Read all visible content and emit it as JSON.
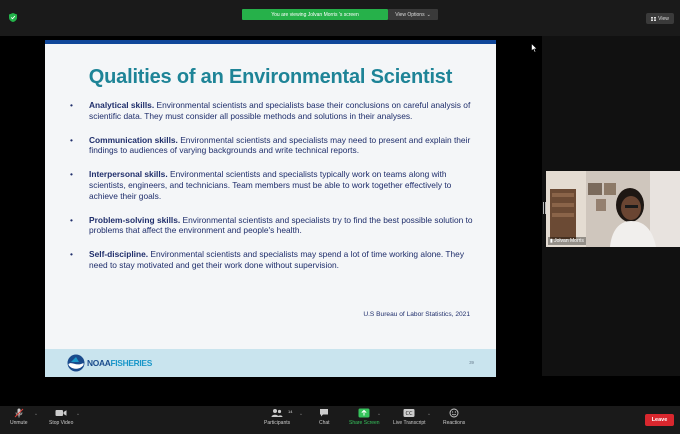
{
  "topbar": {
    "banner": "You are viewing Jolvan Morris 's screen",
    "view_options": "View Options",
    "view": "View"
  },
  "slide": {
    "title": "Qualities of an Environmental Scientist",
    "bullets": [
      {
        "head": "Analytical skills.",
        "text": " Environmental scientists and specialists base their conclusions on careful analysis of scientific data. They must consider all possible methods and solutions in their analyses."
      },
      {
        "head": "Communication skills.",
        "text": " Environmental scientists and specialists may need to present and explain their findings to audiences of varying backgrounds and write technical reports."
      },
      {
        "head": "Interpersonal skills.",
        "text": " Environmental scientists and specialists typically work on teams along with scientists, engineers, and technicians. Team members must be able to work together effectively to achieve their goals."
      },
      {
        "head": "Problem-solving skills.",
        "text": " Environmental scientists and specialists try to find the best possible solution to problems that affect the environment and people's health."
      },
      {
        "head": "Self-discipline.",
        "text": " Environmental scientists and specialists may spend a lot of time working alone. They need to stay motivated and get their work done without supervision."
      }
    ],
    "source": "U.S Bureau of Labor Statistics, 2021",
    "footer_noaa": "NOAA",
    "footer_fisheries": "FISHERIES",
    "page_number": "39"
  },
  "participant": {
    "name": "Jolvan Morris"
  },
  "toolbar": {
    "unmute": "Unmute",
    "stop_video": "Stop Video",
    "participants": "Participants",
    "participant_count": "14",
    "chat": "Chat",
    "share_screen": "Share Screen",
    "live_transcript": "Live Transcript",
    "reactions": "Reactions",
    "leave": "Leave"
  },
  "colors": {
    "banner_green": "#26b14a",
    "title_teal": "#1e8497",
    "text_navy": "#1f2e6b",
    "leave_red": "#d9272e"
  }
}
